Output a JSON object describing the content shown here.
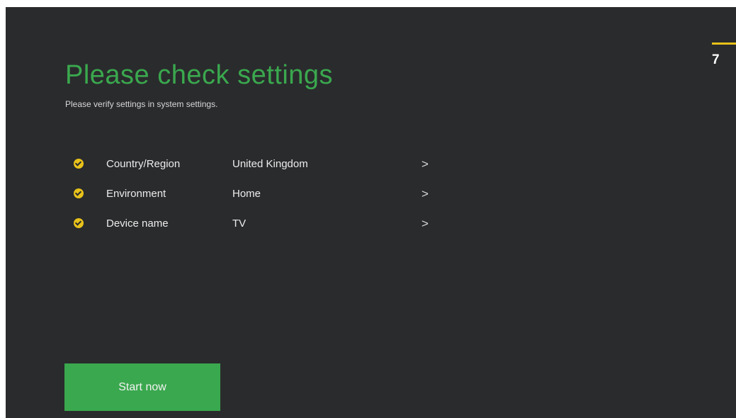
{
  "stepper": {
    "current_step": "7"
  },
  "header": {
    "title": "Please check settings",
    "subtitle": "Please verify settings in system settings."
  },
  "settings": {
    "items": [
      {
        "label": "Country/Region",
        "value": "United Kingdom",
        "icon": "check-circle-icon",
        "chevron": ">"
      },
      {
        "label": "Environment",
        "value": "Home",
        "icon": "check-circle-icon",
        "chevron": ">"
      },
      {
        "label": "Device name",
        "value": "TV",
        "icon": "check-circle-icon",
        "chevron": ">"
      }
    ]
  },
  "actions": {
    "start_label": "Start now"
  },
  "colors": {
    "background": "#2a2b2d",
    "accent_green": "#3aa84e",
    "check_yellow": "#e8c21a",
    "text": "#ececec"
  }
}
